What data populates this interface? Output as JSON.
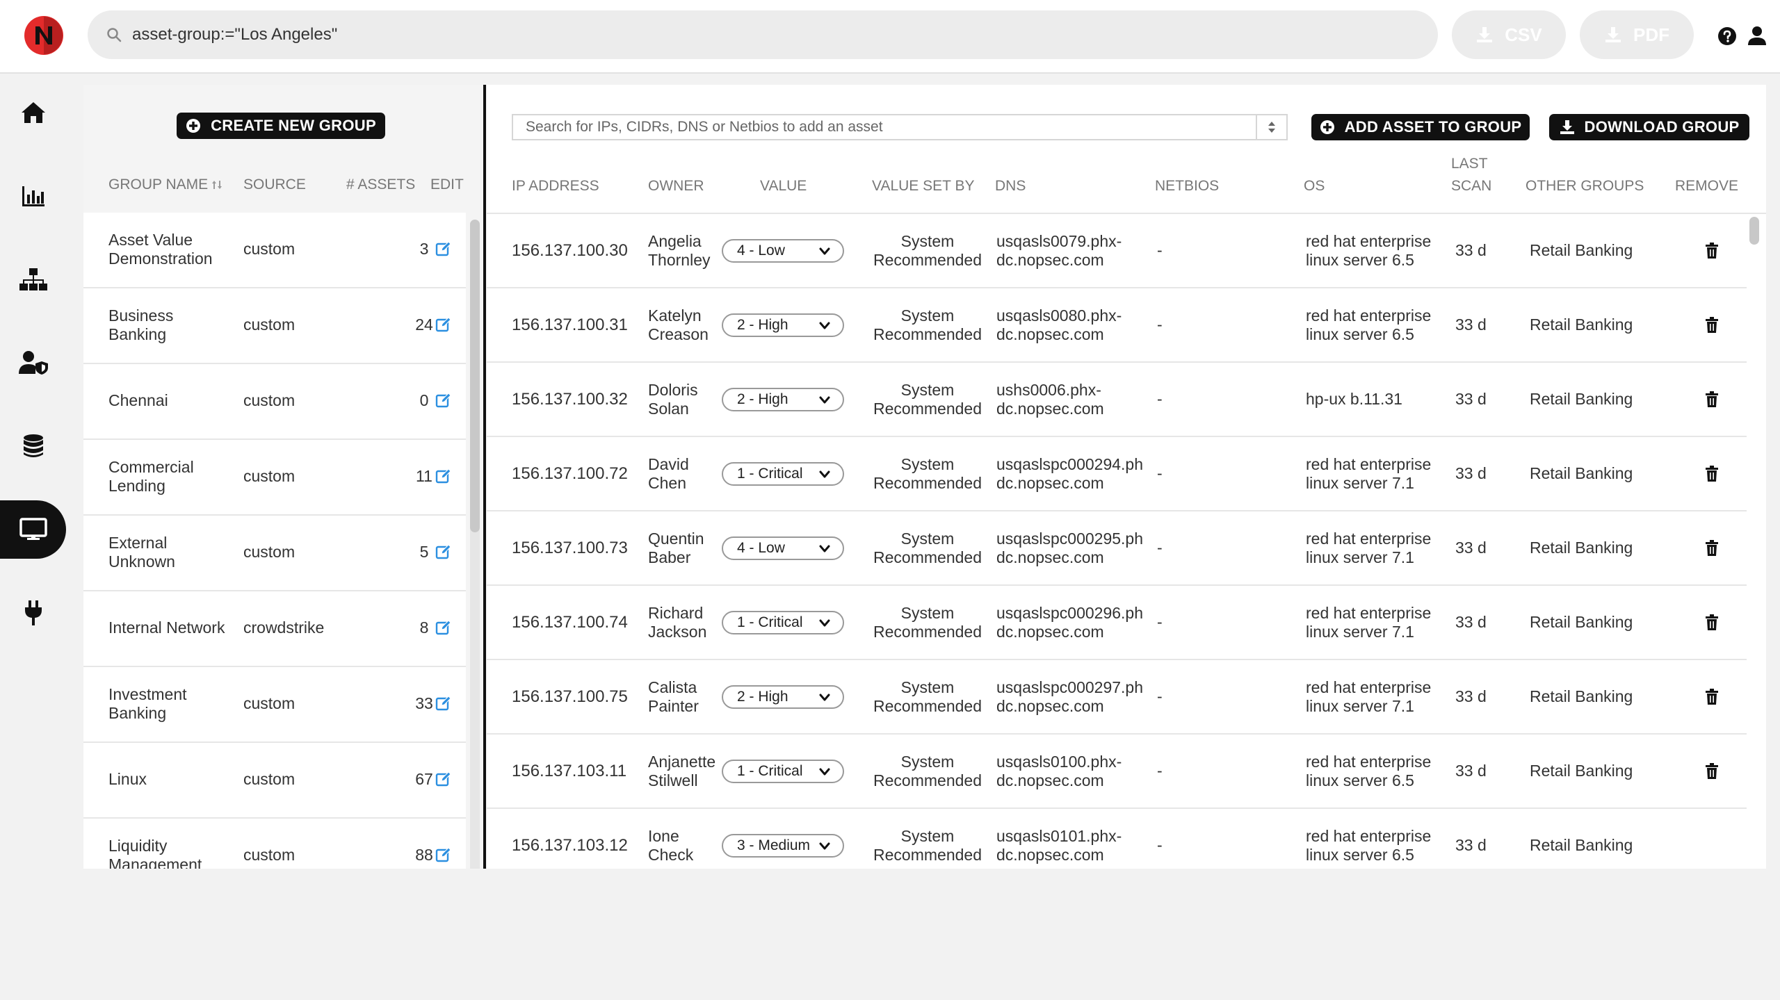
{
  "search": {
    "query": "asset-group:=\"Los Angeles\""
  },
  "export": {
    "csv_label": "CSV",
    "pdf_label": "PDF"
  },
  "nav": [
    "home-icon",
    "chart-icon",
    "network-icon",
    "user-shield-icon",
    "database-icon",
    "monitor-icon",
    "plug-icon"
  ],
  "groups": {
    "create_label": "CREATE NEW GROUP",
    "headers": {
      "name": "GROUP NAME",
      "source": "SOURCE",
      "assets": "# ASSETS",
      "edit": "EDIT"
    },
    "rows": [
      {
        "name": "Asset Value Demonstration",
        "source": "custom",
        "count": "3"
      },
      {
        "name": "Business Banking",
        "source": "custom",
        "count": "24"
      },
      {
        "name": "Chennai",
        "source": "custom",
        "count": "0"
      },
      {
        "name": "Commercial Lending",
        "source": "custom",
        "count": "11"
      },
      {
        "name": "External Unknown",
        "source": "custom",
        "count": "5"
      },
      {
        "name": "Internal Network",
        "source": "crowdstrike",
        "count": "8"
      },
      {
        "name": "Investment Banking",
        "source": "custom",
        "count": "33"
      },
      {
        "name": "Linux",
        "source": "custom",
        "count": "67"
      },
      {
        "name": "Liquidity Management",
        "source": "custom",
        "count": "88"
      }
    ]
  },
  "assets": {
    "search_placeholder": "Search for IPs, CIDRs, DNS or Netbios to add an asset",
    "add_label": "ADD ASSET TO GROUP",
    "download_label": "DOWNLOAD GROUP",
    "headers": {
      "ip": "IP ADDRESS",
      "owner": "OWNER",
      "value": "VALUE",
      "setby": "VALUE SET BY",
      "dns": "DNS",
      "netbios": "NETBIOS",
      "os": "OS",
      "last": "LAST",
      "scan": "SCAN",
      "other": "OTHER GROUPS",
      "remove": "REMOVE"
    },
    "rows": [
      {
        "ip": "156.137.100.30",
        "owner1": "Angelia",
        "owner2": "Thornley",
        "value": "4 - Low",
        "setby1": "System",
        "setby2": "Recommended",
        "dns1": "usqasls0079.phx-",
        "dns2": "dc.nopsec.com",
        "netbios": "-",
        "os1": "red hat enterprise",
        "os2": "linux server 6.5",
        "scan": "33 d",
        "other": "Retail Banking"
      },
      {
        "ip": "156.137.100.31",
        "owner1": "Katelyn",
        "owner2": "Creason",
        "value": "2 - High",
        "setby1": "System",
        "setby2": "Recommended",
        "dns1": "usqasls0080.phx-",
        "dns2": "dc.nopsec.com",
        "netbios": "-",
        "os1": "red hat enterprise",
        "os2": "linux server 6.5",
        "scan": "33 d",
        "other": "Retail Banking"
      },
      {
        "ip": "156.137.100.32",
        "owner1": "Doloris",
        "owner2": "Solan",
        "value": "2 - High",
        "setby1": "System",
        "setby2": "Recommended",
        "dns1": "ushs0006.phx-",
        "dns2": "dc.nopsec.com",
        "netbios": "-",
        "os1": "hp-ux b.11.31",
        "os2": "",
        "scan": "33 d",
        "other": "Retail Banking"
      },
      {
        "ip": "156.137.100.72",
        "owner1": "David",
        "owner2": "Chen",
        "value": "1 - Critical",
        "setby1": "System",
        "setby2": "Recommended",
        "dns1": "usqaslspc000294.ph",
        "dns2": "dc.nopsec.com",
        "netbios": "-",
        "os1": "red hat enterprise",
        "os2": "linux server 7.1",
        "scan": "33 d",
        "other": "Retail Banking"
      },
      {
        "ip": "156.137.100.73",
        "owner1": "Quentin",
        "owner2": "Baber",
        "value": "4 - Low",
        "setby1": "System",
        "setby2": "Recommended",
        "dns1": "usqaslspc000295.ph",
        "dns2": "dc.nopsec.com",
        "netbios": "-",
        "os1": "red hat enterprise",
        "os2": "linux server 7.1",
        "scan": "33 d",
        "other": "Retail Banking"
      },
      {
        "ip": "156.137.100.74",
        "owner1": "Richard",
        "owner2": "Jackson",
        "value": "1 - Critical",
        "setby1": "System",
        "setby2": "Recommended",
        "dns1": "usqaslspc000296.ph",
        "dns2": "dc.nopsec.com",
        "netbios": "-",
        "os1": "red hat enterprise",
        "os2": "linux server 7.1",
        "scan": "33 d",
        "other": "Retail Banking"
      },
      {
        "ip": "156.137.100.75",
        "owner1": "Calista",
        "owner2": "Painter",
        "value": "2 - High",
        "setby1": "System",
        "setby2": "Recommended",
        "dns1": "usqaslspc000297.ph",
        "dns2": "dc.nopsec.com",
        "netbios": "-",
        "os1": "red hat enterprise",
        "os2": "linux server 7.1",
        "scan": "33 d",
        "other": "Retail Banking"
      },
      {
        "ip": "156.137.103.11",
        "owner1": "Anjanette",
        "owner2": "Stilwell",
        "value": "1 - Critical",
        "setby1": "System",
        "setby2": "Recommended",
        "dns1": "usqasls0100.phx-",
        "dns2": "dc.nopsec.com",
        "netbios": "-",
        "os1": "red hat enterprise",
        "os2": "linux server 6.5",
        "scan": "33 d",
        "other": "Retail Banking"
      },
      {
        "ip": "156.137.103.12",
        "owner1": "Ione",
        "owner2": "Check",
        "value": "3 - Medium",
        "setby1": "System",
        "setby2": "Recommended",
        "dns1": "usqasls0101.phx-",
        "dns2": "dc.nopsec.com",
        "netbios": "-",
        "os1": "red hat enterprise",
        "os2": "linux server 6.5",
        "scan": "33 d",
        "other": "Retail Banking"
      }
    ]
  }
}
